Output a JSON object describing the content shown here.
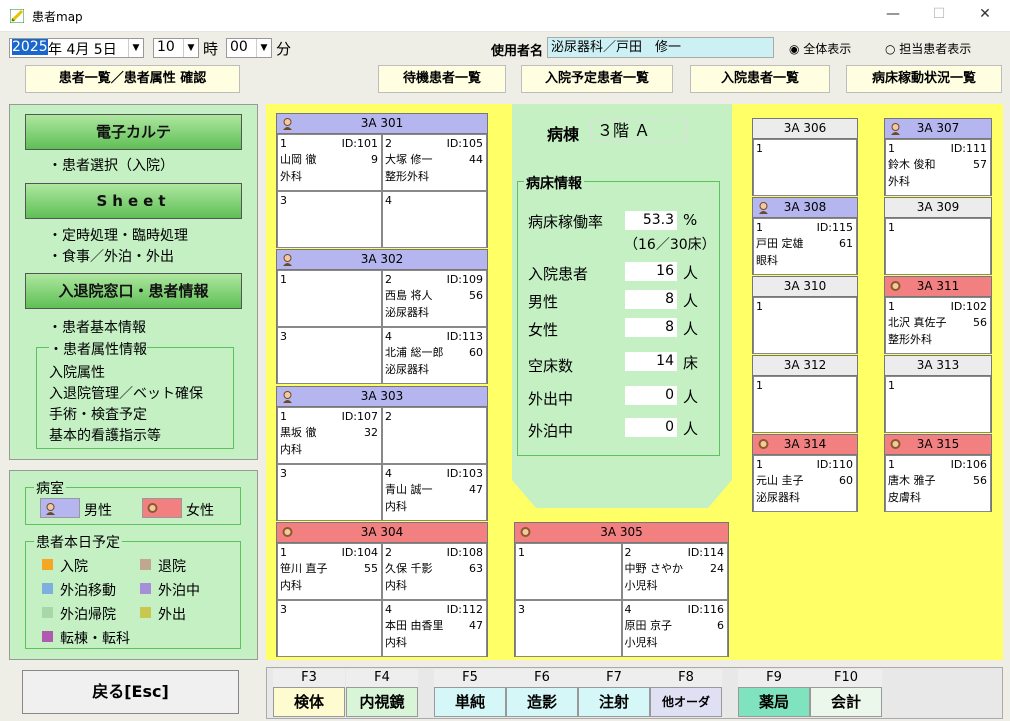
{
  "window": {
    "title": "患者map"
  },
  "toolbar": {
    "year": "2025",
    "date_rest": "年 4月 5日",
    "hour": "10",
    "hour_unit": "時",
    "minute": "00",
    "minute_unit": "分",
    "user_label": "使用者名",
    "user_value": "泌尿器科／戸田　修一",
    "radio_all": "全体表示",
    "radio_mine": "担当患者表示"
  },
  "menu": {
    "patients": "患者一覧／患者属性 確認",
    "waiting": "待機患者一覧",
    "scheduled": "入院予定患者一覧",
    "inpatients": "入院患者一覧",
    "bed_status": "病床稼動状況一覧"
  },
  "left": {
    "btn_ehr": "電子カルテ",
    "ehr_sub": "・患者選択（入院）",
    "btn_sheet": "Sheet",
    "sheet_sub1": "・定時処理・臨時処理",
    "sheet_sub2": "・食事／外泊・外出",
    "btn_admission": "入退院窓口・患者情報",
    "adm_sub1": "・患者基本情報",
    "adm_grp": "・患者属性情報",
    "adm_items": [
      "入院属性",
      "入退院管理／ベット確保",
      "手術・検査予定",
      "基本的看護指示等"
    ]
  },
  "legend": {
    "room_label": "病室",
    "male": "男性",
    "female": "女性",
    "schedule_label": "患者本日予定",
    "items": [
      {
        "label": "入院",
        "color": "#f5a623"
      },
      {
        "label": "退院",
        "color": "#c0a890"
      },
      {
        "label": "外泊移動",
        "color": "#7faee0"
      },
      {
        "label": "外泊中",
        "color": "#a58fd8"
      },
      {
        "label": "外泊帰院",
        "color": "#a8d8a8"
      },
      {
        "label": "外出",
        "color": "#c8c850"
      },
      {
        "label": "転棟・転科",
        "color": "#b05ab0"
      }
    ]
  },
  "ward": {
    "label": "病棟",
    "value": "３階 Ａ",
    "info_title": "病床情報",
    "occupancy_label": "病床稼働率",
    "occupancy": "53.3",
    "occupancy_unit": "%",
    "occupancy_detail": "（16／30床）",
    "inpatients_label": "入院患者",
    "inpatients": "16",
    "inpatients_unit": "人",
    "male_label": "男性",
    "male": "8",
    "male_unit": "人",
    "female_label": "女性",
    "female": "8",
    "female_unit": "人",
    "vacant_label": "空床数",
    "vacant": "14",
    "vacant_unit": "床",
    "out_label": "外出中",
    "out": "0",
    "out_unit": "人",
    "overnight_label": "外泊中",
    "overnight": "0",
    "overnight_unit": "人"
  },
  "rooms": {
    "r301": {
      "name": "3A 301",
      "gender": "male",
      "beds": [
        {
          "no": "1",
          "id": "ID:101",
          "name": "山岡 徹",
          "age": "9",
          "dept": "外科"
        },
        {
          "no": "2",
          "id": "ID:105",
          "name": "大塚 修一",
          "age": "44",
          "dept": "整形外科"
        },
        {
          "no": "3"
        },
        {
          "no": "4"
        }
      ]
    },
    "r302": {
      "name": "3A 302",
      "gender": "male",
      "beds": [
        {
          "no": "1"
        },
        {
          "no": "2",
          "id": "ID:109",
          "name": "西島 将人",
          "age": "56",
          "dept": "泌尿器科"
        },
        {
          "no": "3"
        },
        {
          "no": "4",
          "id": "ID:113",
          "name": "北浦 総一郎",
          "age": "60",
          "dept": "泌尿器科"
        }
      ]
    },
    "r303": {
      "name": "3A 303",
      "gender": "male",
      "beds": [
        {
          "no": "1",
          "id": "ID:107",
          "name": "黒坂 徹",
          "age": "32",
          "dept": "内科"
        },
        {
          "no": "2"
        },
        {
          "no": "3"
        },
        {
          "no": "4",
          "id": "ID:103",
          "name": "青山 誠一",
          "age": "47",
          "dept": "内科"
        }
      ]
    },
    "r304": {
      "name": "3A 304",
      "gender": "female",
      "beds": [
        {
          "no": "1",
          "id": "ID:104",
          "name": "笹川 直子",
          "age": "55",
          "dept": "内科"
        },
        {
          "no": "2",
          "id": "ID:108",
          "name": "久保 千影",
          "age": "63",
          "dept": "内科"
        },
        {
          "no": "3"
        },
        {
          "no": "4",
          "id": "ID:112",
          "name": "本田 由香里",
          "age": "47",
          "dept": "内科"
        }
      ]
    },
    "r305": {
      "name": "3A 305",
      "gender": "female",
      "beds": [
        {
          "no": "1"
        },
        {
          "no": "2",
          "id": "ID:114",
          "name": "中野 さやか",
          "age": "24",
          "dept": "小児科"
        },
        {
          "no": "3"
        },
        {
          "no": "4",
          "id": "ID:116",
          "name": "原田 京子",
          "age": "6",
          "dept": "小児科"
        }
      ]
    },
    "r306": {
      "name": "3A 306",
      "gender": "empty",
      "beds": [
        {
          "no": "1"
        }
      ]
    },
    "r307": {
      "name": "3A 307",
      "gender": "male",
      "beds": [
        {
          "no": "1",
          "id": "ID:111",
          "name": "鈴木 俊和",
          "age": "57",
          "dept": "外科"
        }
      ]
    },
    "r308": {
      "name": "3A 308",
      "gender": "male",
      "beds": [
        {
          "no": "1",
          "id": "ID:115",
          "name": "戸田 定雄",
          "age": "61",
          "dept": "眼科"
        }
      ]
    },
    "r309": {
      "name": "3A 309",
      "gender": "empty",
      "beds": [
        {
          "no": "1"
        }
      ]
    },
    "r310": {
      "name": "3A 310",
      "gender": "empty",
      "beds": [
        {
          "no": "1"
        }
      ]
    },
    "r311": {
      "name": "3A 311",
      "gender": "female",
      "beds": [
        {
          "no": "1",
          "id": "ID:102",
          "name": "北沢 真佐子",
          "age": "56",
          "dept": "整形外科"
        }
      ]
    },
    "r312": {
      "name": "3A 312",
      "gender": "empty",
      "beds": [
        {
          "no": "1"
        }
      ]
    },
    "r313": {
      "name": "3A 313",
      "gender": "empty",
      "beds": [
        {
          "no": "1"
        }
      ]
    },
    "r314": {
      "name": "3A 314",
      "gender": "female",
      "beds": [
        {
          "no": "1",
          "id": "ID:110",
          "name": "元山 圭子",
          "age": "60",
          "dept": "泌尿器科"
        }
      ]
    },
    "r315": {
      "name": "3A 315",
      "gender": "female",
      "beds": [
        {
          "no": "1",
          "id": "ID:106",
          "name": "唐木 雅子",
          "age": "56",
          "dept": "皮膚科"
        }
      ]
    }
  },
  "footer": {
    "back": "戻る[Esc]",
    "fkeys": [
      {
        "key": "F3",
        "label": "検体",
        "bg": "#fffbd0"
      },
      {
        "key": "F4",
        "label": "内視鏡",
        "bg": "#d8f5d8"
      },
      {
        "key": "F5",
        "label": "単純",
        "bg": "#d5f7f7"
      },
      {
        "key": "F6",
        "label": "造影",
        "bg": "#d5f7f7"
      },
      {
        "key": "F7",
        "label": "注射",
        "bg": "#d5f7f7"
      },
      {
        "key": "F8",
        "label": "他オーダ",
        "bg": "#e0e0f5"
      },
      {
        "key": "F9",
        "label": "薬局",
        "bg": "#7fe3c0"
      },
      {
        "key": "F10",
        "label": "会計",
        "bg": "#eaf7ea"
      }
    ]
  }
}
